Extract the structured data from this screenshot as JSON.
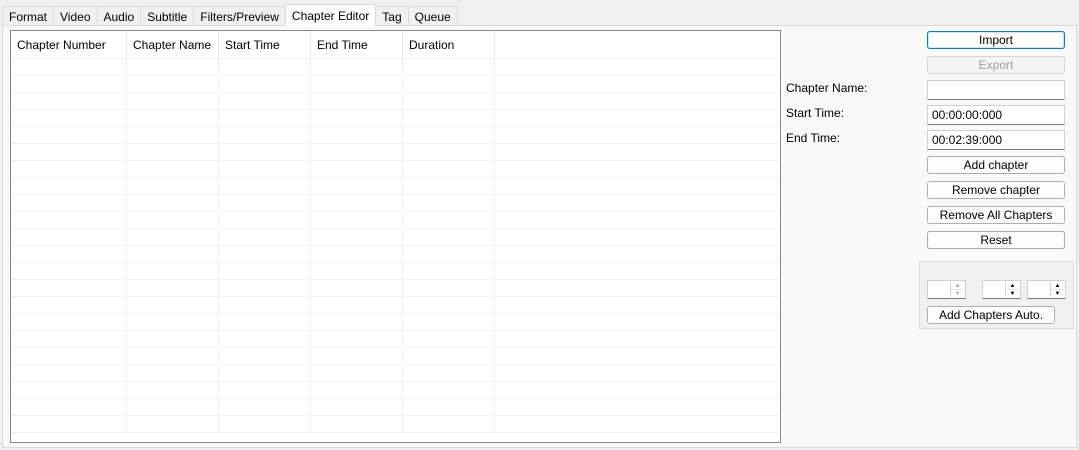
{
  "tabs": [
    {
      "label": "Format"
    },
    {
      "label": "Video"
    },
    {
      "label": "Audio"
    },
    {
      "label": "Subtitle"
    },
    {
      "label": "Filters/Preview"
    },
    {
      "label": "Chapter Editor",
      "active": true
    },
    {
      "label": "Tag"
    },
    {
      "label": "Queue"
    }
  ],
  "table": {
    "columns": [
      "Chapter Number",
      "Chapter Name",
      "Start Time",
      "End Time",
      "Duration"
    ],
    "rows": []
  },
  "buttons": {
    "import": "Import",
    "export": "Export",
    "add_chapter": "Add chapter",
    "remove_chapter": "Remove chapter",
    "remove_all": "Remove All Chapters",
    "reset": "Reset",
    "add_auto": "Add Chapters Auto."
  },
  "fields": {
    "chapter_name_label": "Chapter Name:",
    "chapter_name_value": "",
    "start_time_label": "Start Time:",
    "start_time_value": "00:00:00:000",
    "end_time_label": "End Time:",
    "end_time_value": "00:02:39:000"
  },
  "auto": {
    "spin1": "",
    "spin2": "",
    "spin3": ""
  }
}
